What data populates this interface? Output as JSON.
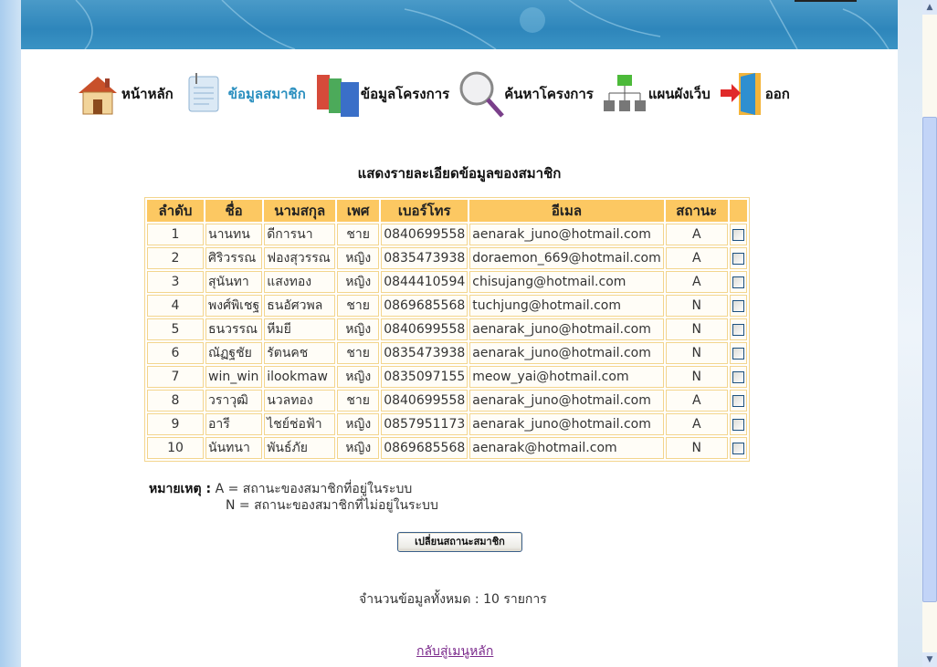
{
  "nav": [
    {
      "label": "หน้าหลัก",
      "icon": "house-icon"
    },
    {
      "label": "ข้อมูลสมาชิก",
      "icon": "document-icon",
      "active": true
    },
    {
      "label": "ข้อมูลโครงการ",
      "icon": "binders-icon"
    },
    {
      "label": "ค้นหาโครงการ",
      "icon": "magnifier-icon"
    },
    {
      "label": "แผนผังเว็บ",
      "icon": "sitemap-icon"
    },
    {
      "label": "ออก",
      "icon": "exit-door-icon"
    }
  ],
  "title": "แสดงรายละเอียดข้อมูลของสมาชิก",
  "table": {
    "headers": [
      "ลำดับ",
      "ชื่อ",
      "นามสกุล",
      "เพศ",
      "เบอร์โทร",
      "อีเมล",
      "สถานะ",
      ""
    ],
    "rows": [
      [
        "1",
        "นานทน",
        "ดีการนา",
        "ชาย",
        "0840699558",
        "aenarak_juno@hotmail.com",
        "A"
      ],
      [
        "2",
        "ศิริวรรณ",
        "ฟองสุวรรณ",
        "หญิง",
        "0835473938",
        "doraemon_669@hotmail.com",
        "A"
      ],
      [
        "3",
        "สุนันทา",
        "แสงทอง",
        "หญิง",
        "0844410594",
        "chisujang@hotmail.com",
        "A"
      ],
      [
        "4",
        "พงศ์พิเชฐ",
        "ธนอัศวพล",
        "ชาย",
        "0869685568",
        "tuchjung@hotmail.com",
        "N"
      ],
      [
        "5",
        "ธนวรรณ",
        "หีมยี",
        "หญิง",
        "0840699558",
        "aenarak_juno@hotmail.com",
        "N"
      ],
      [
        "6",
        "ณัฏฐชัย",
        "รัตนคช",
        "ชาย",
        "0835473938",
        "aenarak_juno@hotmail.com",
        "N"
      ],
      [
        "7",
        "win_win",
        "ilookmaw",
        "หญิง",
        "0835097155",
        "meow_yai@hotmail.com",
        "N"
      ],
      [
        "8",
        "วราวุฒิ",
        "นวลทอง",
        "ชาย",
        "0840699558",
        "aenarak_juno@hotmail.com",
        "A"
      ],
      [
        "9",
        "อารี",
        "ไชย์ช่อฟ้า",
        "หญิง",
        "0857951173",
        "aenarak_juno@hotmail.com",
        "A"
      ],
      [
        "10",
        "นันทนา",
        "พันธ์ภัย",
        "หญิง",
        "0869685568",
        "aenarak@hotmail.com",
        "N"
      ]
    ]
  },
  "note": {
    "label": "หมายเหตุ :",
    "line1": "A = สถานะของสมาชิกที่อยู่ในระบบ",
    "line2": "N = สถานะของสมาชิกที่ไม่อยู่ในระบบ"
  },
  "button": "เปลี่ยนสถานะสมาชิก",
  "count": "จำนวนข้อมูลทั้งหมด : 10 รายการ",
  "back_link": "กลับสู่เมนูหลัก"
}
